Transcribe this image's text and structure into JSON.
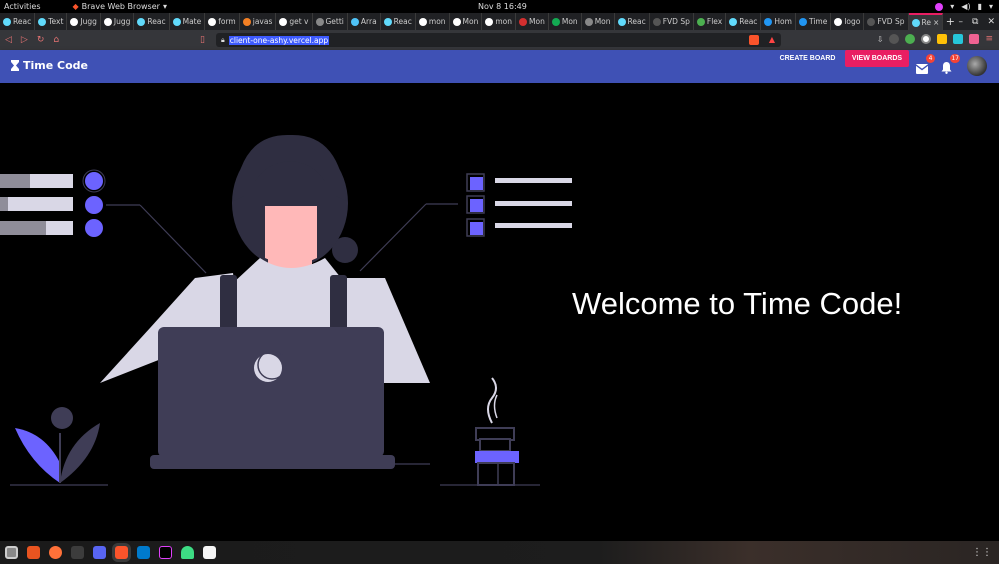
{
  "system": {
    "activities": "Activities",
    "app_name": "Brave Web Browser",
    "clock": "Nov 8  16:49"
  },
  "tabs": [
    {
      "label": "Reac",
      "color": "#61dafb"
    },
    {
      "label": "Text",
      "color": "#61dafb"
    },
    {
      "label": "Jugg",
      "color": "#ffffff"
    },
    {
      "label": "Jugg",
      "color": "#ffffff"
    },
    {
      "label": "Reac",
      "color": "#61dafb"
    },
    {
      "label": "Mate",
      "color": "#61dafb"
    },
    {
      "label": "form",
      "color": "#ffffff"
    },
    {
      "label": "javas",
      "color": "#f48024"
    },
    {
      "label": "get v",
      "color": "#ffffff"
    },
    {
      "label": "Getti",
      "color": "#888888"
    },
    {
      "label": "Arra",
      "color": "#4fc3f7"
    },
    {
      "label": "Reac",
      "color": "#61dafb"
    },
    {
      "label": "mon",
      "color": "#ffffff"
    },
    {
      "label": "Mon",
      "color": "#ffffff"
    },
    {
      "label": "mon",
      "color": "#ffffff"
    },
    {
      "label": "Mon",
      "color": "#d32f2f"
    },
    {
      "label": "Mon",
      "color": "#13aa52"
    },
    {
      "label": "Mon",
      "color": "#888888"
    },
    {
      "label": "Reac",
      "color": "#61dafb"
    },
    {
      "label": "FVD Sp",
      "color": "#555555"
    },
    {
      "label": "Flex",
      "color": "#4caf50"
    },
    {
      "label": "Reac",
      "color": "#61dafb"
    },
    {
      "label": "Hom",
      "color": "#2196f3"
    },
    {
      "label": "Time",
      "color": "#2196f3"
    },
    {
      "label": "logo",
      "color": "#ffffff"
    },
    {
      "label": "FVD Sp",
      "color": "#555555"
    },
    {
      "label": "Re",
      "color": "#61dafb",
      "active": true
    }
  ],
  "address": {
    "url": "client-one-ashy.vercel.app"
  },
  "app": {
    "brand": "Time Code",
    "create_board": "CREATE BOARD",
    "view_boards": "VIEW BOARDS",
    "mail_count": "4",
    "notif_count": "17"
  },
  "hero": {
    "welcome": "Welcome to Time Code!"
  },
  "colors": {
    "primary": "#3f51b5",
    "accent": "#e91e63",
    "illustration_accent": "#6c63ff"
  }
}
